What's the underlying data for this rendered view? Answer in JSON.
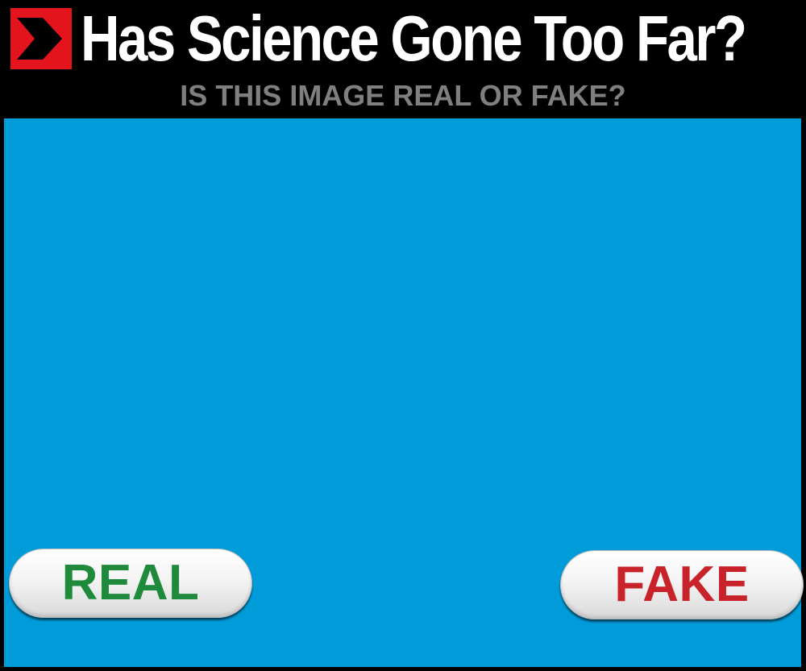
{
  "header": {
    "title": "Has Science Gone Too Far?",
    "subtitle": "IS THIS IMAGE REAL OR FAKE?",
    "logo_icon": "red-chevron-arrow-icon"
  },
  "choices": {
    "real_label": "REAL",
    "fake_label": "FAKE"
  },
  "colors": {
    "background": "#000000",
    "title_text": "#ffffff",
    "subtitle_text": "#7f7f7f",
    "image_panel": "#009bd9",
    "logo_red": "#e3141b",
    "real_text": "#1f8a3c",
    "fake_text": "#c8232a"
  }
}
